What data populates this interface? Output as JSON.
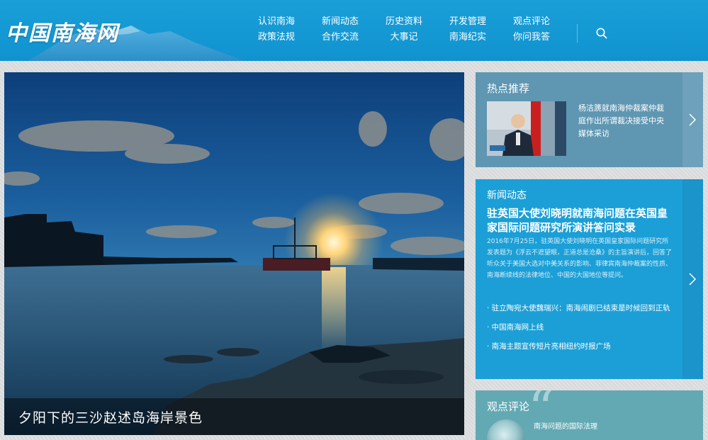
{
  "header": {
    "logo_text": "中国南海网",
    "nav_items": [
      {
        "label": "认识南海"
      },
      {
        "label": "新闻动态"
      },
      {
        "label": "历史资料"
      },
      {
        "label": "开发管理"
      },
      {
        "label": "观点评论"
      },
      {
        "label": "政策法规"
      },
      {
        "label": "合作交流"
      },
      {
        "label": "大事记"
      },
      {
        "label": "南海纪实"
      },
      {
        "label": "你问我答"
      }
    ],
    "search_icon": "search-icon"
  },
  "hero": {
    "caption": "夕阳下的三沙赵述岛海岸景色"
  },
  "hot_recommend": {
    "title": "热点推荐",
    "story": "杨洁篪就南海仲裁案仲裁庭作出所谓裁决接受中央媒体采访",
    "arrow_icon": "chevron-right-icon"
  },
  "news": {
    "title": "新闻动态",
    "headline": "驻英国大使刘晓明就南海问题在英国皇家国际问题研究所演讲答问实录",
    "summary": "2016年7月25日，驻英国大使刘晓明在英国皇家国际问题研究所发表题为《浮云不遮望眼，正道总是沧桑》的主旨演讲后，回答了听众关于美国大选对中美关系的影响、菲律宾南海仲裁案的性质、南海断续线的法律地位、中国的大国地位等提问。",
    "links": [
      "· 驻立陶宛大使魏瑞兴：南海闹剧已结束是时候回到正轨",
      "· 中国南海网上线",
      "· 南海主题宣传短片亮相纽约时报广场"
    ],
    "arrow_icon": "chevron-right-icon"
  },
  "opinion": {
    "title": "观点评论",
    "item": "南海问题的国际法理"
  },
  "colors": {
    "header_blue": "#1a9fd8",
    "news_blue": "#1b9fd6",
    "hot_gray_blue": "#5f96b2",
    "opinion_teal": "#62a9b3"
  }
}
